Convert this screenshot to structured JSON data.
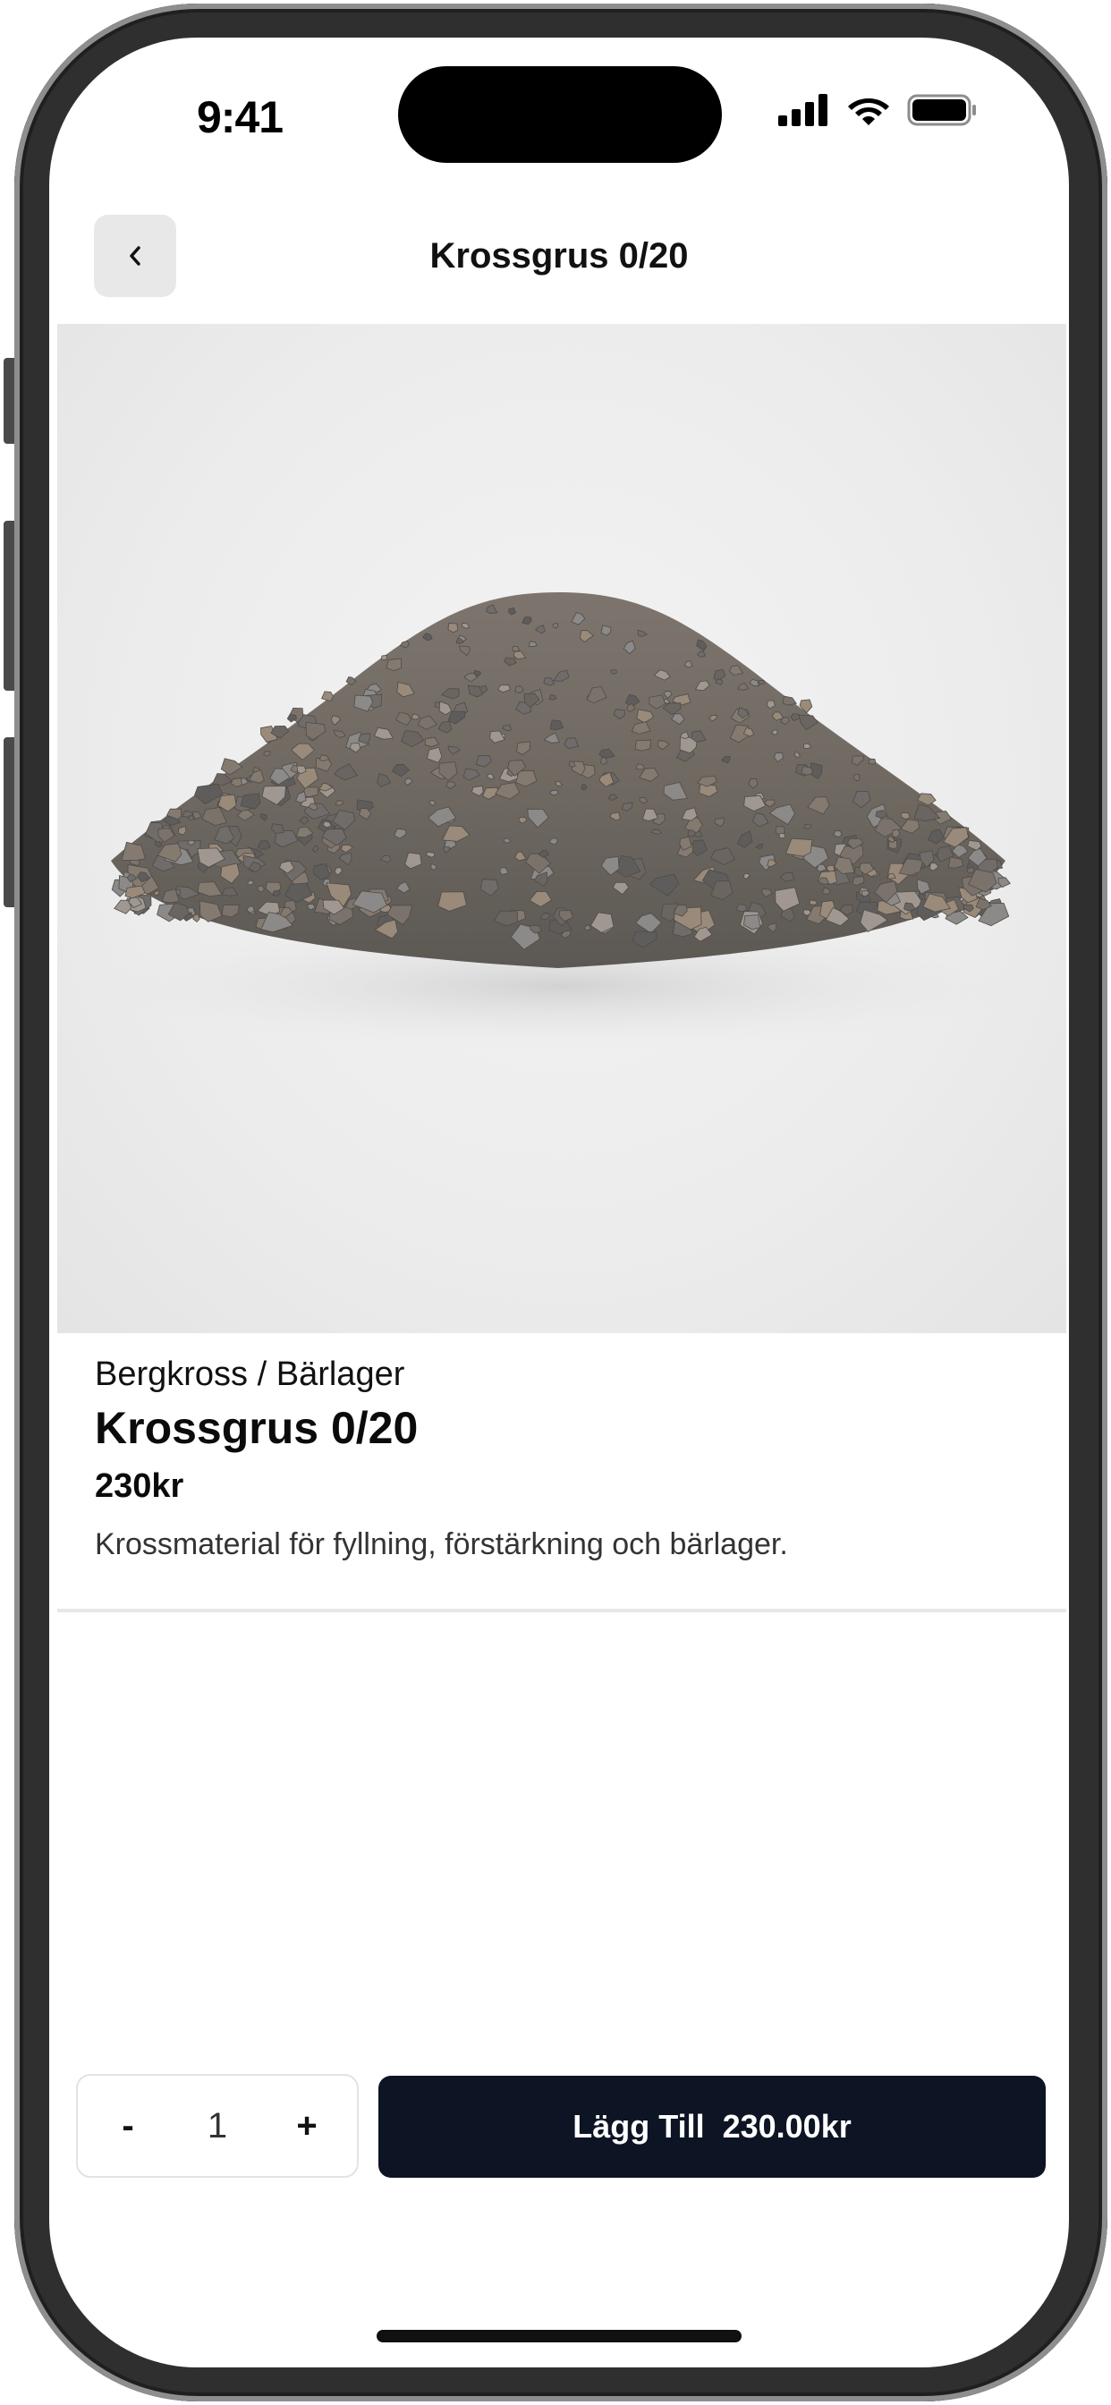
{
  "status_bar": {
    "time": "9:41"
  },
  "header": {
    "title": "Krossgrus 0/20",
    "back_icon": "chevron-left-icon"
  },
  "product": {
    "image_alt": "gravel-pile-image",
    "category": "Bergkross / Bärlager",
    "name": "Krossgrus 0/20",
    "price": "230kr",
    "description": "Krossmaterial för fyllning, förstärkning och bärlager."
  },
  "cart_bar": {
    "decrement_label": "-",
    "quantity": "1",
    "increment_label": "+",
    "add_label": "Lägg Till",
    "add_total": "230.00kr"
  },
  "colors": {
    "primary_button": "#0d1424",
    "back_button_bg": "#e8e8e8",
    "divider": "#e7e7e7"
  }
}
